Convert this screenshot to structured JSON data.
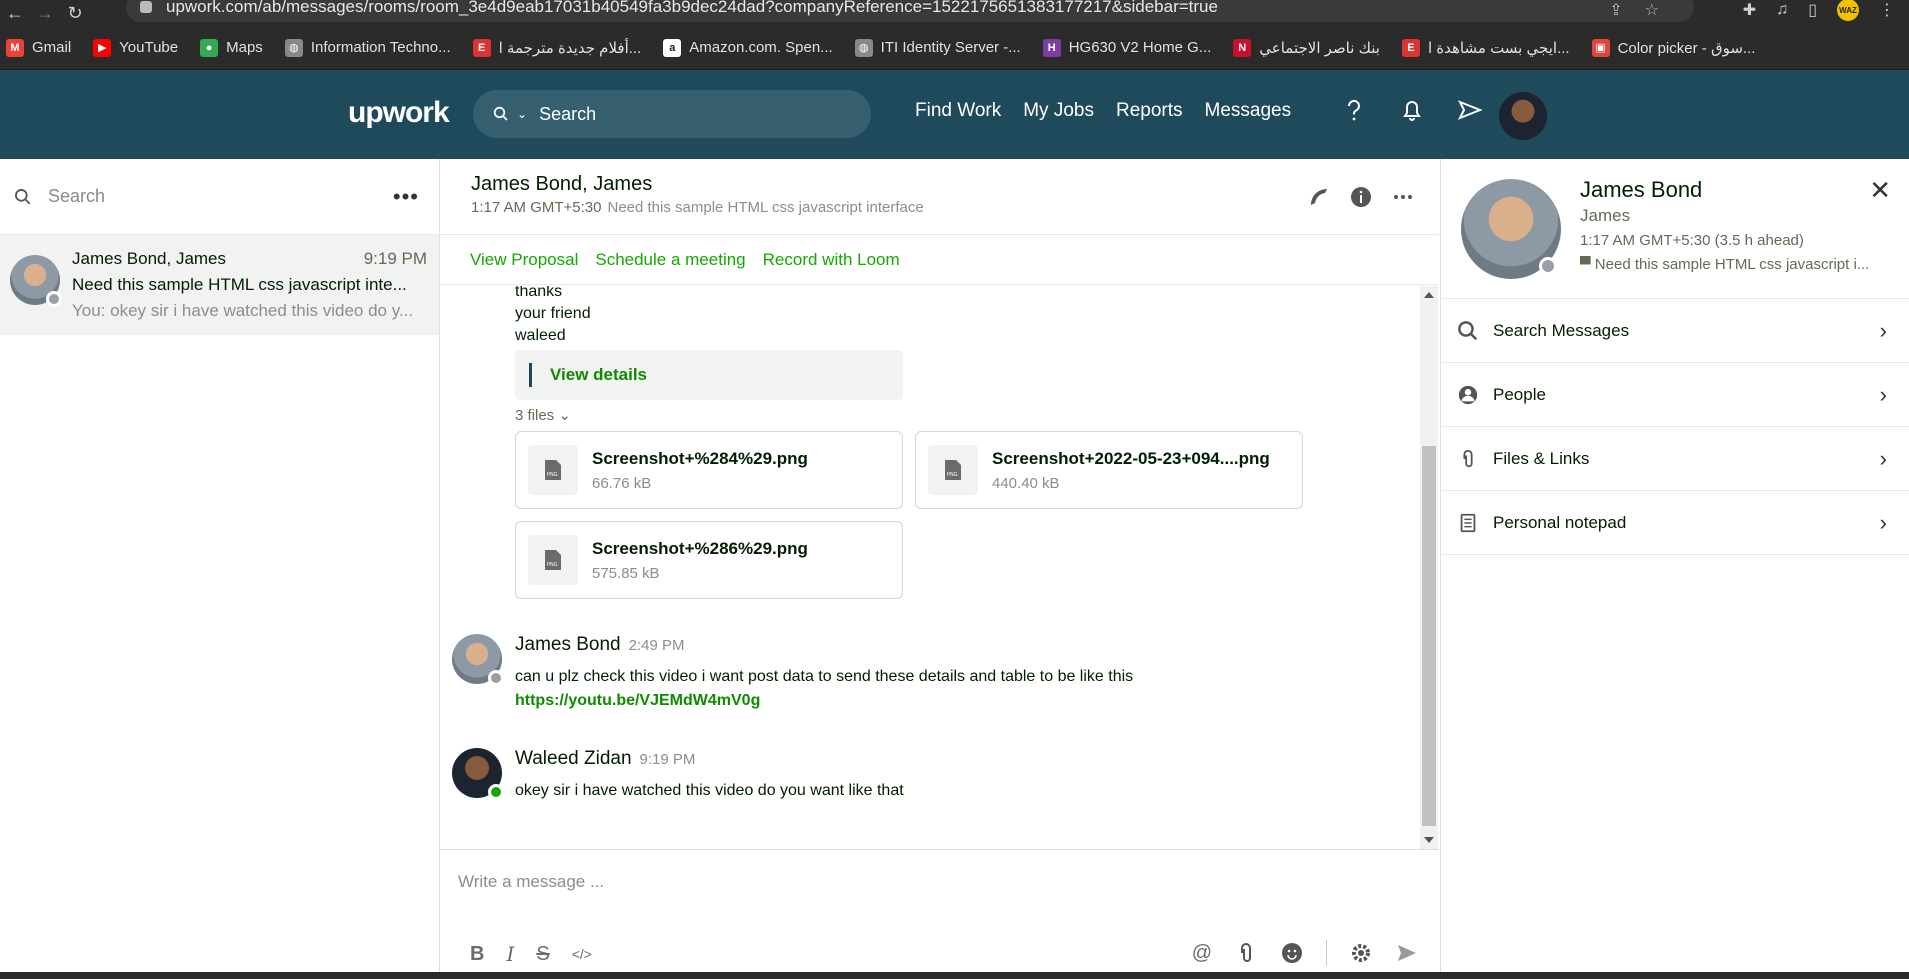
{
  "browser": {
    "url": "upwork.com/ab/messages/rooms/room_3e4d9eab17031b40549fa3b9dec24dad?companyReference=1522175651383177217&sidebar=true",
    "profile_label": "WAZ",
    "bookmarks": [
      {
        "label": "Gmail",
        "color": "#ea4335",
        "glyph": "M"
      },
      {
        "label": "YouTube",
        "color": "#ff0000",
        "glyph": "▶"
      },
      {
        "label": "Maps",
        "color": "#34a853",
        "glyph": "●"
      },
      {
        "label": "Information Techno...",
        "color": "#888888",
        "glyph": "◍"
      },
      {
        "label": "أفلام جديدة مترجمة ا...",
        "color": "#d33",
        "glyph": "E"
      },
      {
        "label": "Amazon.com. Spen...",
        "color": "#ffffff",
        "glyph": "a"
      },
      {
        "label": "ITI Identity Server -...",
        "color": "#888888",
        "glyph": "◍"
      },
      {
        "label": "HG630 V2 Home G...",
        "color": "#7b3fa0",
        "glyph": "H"
      },
      {
        "label": "بنك ناصر الاجتماعي",
        "color": "#c8102e",
        "glyph": "N"
      },
      {
        "label": "ايجي بست مشاهدة ا...",
        "color": "#d33",
        "glyph": "E"
      },
      {
        "label": "Color picker - سوق...",
        "color": "#e0463c",
        "glyph": "▣"
      }
    ]
  },
  "header": {
    "logo": "upwork",
    "search_label": "Search",
    "nav": [
      "Find Work",
      "My Jobs",
      "Reports",
      "Messages"
    ]
  },
  "rooms": {
    "search_placeholder": "Search",
    "items": [
      {
        "name": "James Bond, James",
        "time": "9:19 PM",
        "line1": "Need this sample HTML css javascript inte...",
        "line2": "You: okey sir i have watched this video do y..."
      }
    ]
  },
  "chat": {
    "title": "James Bond, James",
    "local_time": "1:17 AM GMT+5:30",
    "job": "Need this sample HTML css javascript interface",
    "links": [
      "View Proposal",
      "Schedule a meeting",
      "Record with Loom"
    ],
    "prior_lines": [
      "thanks",
      "your friend",
      "waleed"
    ],
    "view_details": "View details",
    "files_label": "3 files",
    "files": [
      {
        "name": "Screenshot+%284%29.png",
        "size": "66.76 kB"
      },
      {
        "name": "Screenshot+2022-05-23+094....png",
        "size": "440.40 kB"
      },
      {
        "name": "Screenshot+%286%29.png",
        "size": "575.85 kB"
      }
    ],
    "messages": [
      {
        "author": "James Bond",
        "time": "2:49 PM",
        "text": "can u plz check this video i want post data to send these details and table to be like this",
        "link": "https://youtu.be/VJEMdW4mV0g",
        "status_color": "#9aa0a6"
      },
      {
        "author": "Waleed Zidan",
        "time": "9:19 PM",
        "text": "okey sir i have watched this video do you want like that",
        "link": "",
        "status_color": "#14a800"
      }
    ],
    "composer_placeholder": "Write a message ..."
  },
  "sidebar": {
    "name": "James Bond",
    "subtitle": "James",
    "time": "1:17 AM GMT+5:30 (3.5 h ahead)",
    "job": "Need this sample HTML css javascript i...",
    "items": [
      {
        "label": "Search Messages",
        "icon": "search-icon"
      },
      {
        "label": "People",
        "icon": "person-icon"
      },
      {
        "label": "Files & Links",
        "icon": "paperclip-icon"
      },
      {
        "label": "Personal notepad",
        "icon": "notepad-icon"
      }
    ]
  },
  "colors": {
    "header_bg": "#1f4a5c",
    "accent_green": "#14a800",
    "online": "#14a800",
    "offline": "#9aa0a6"
  }
}
